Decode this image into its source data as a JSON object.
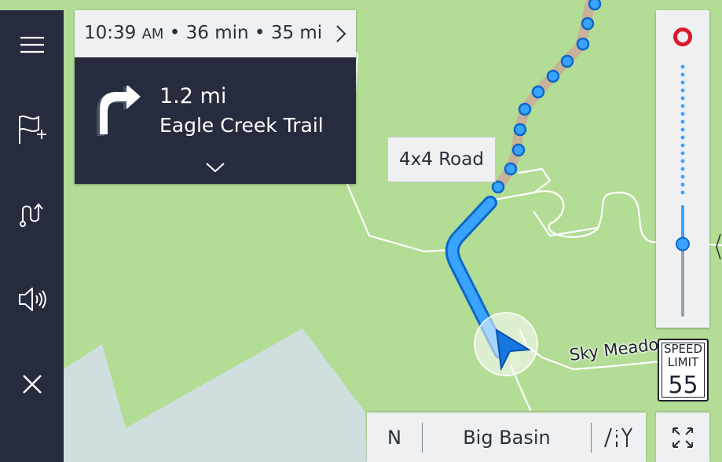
{
  "colors": {
    "map_land": "#b3dc95",
    "map_water": "#cfdfe0",
    "route": "#3aa3ff",
    "route_outline": "#0c68c8",
    "dotted_route": "#c8b298",
    "panel_dark": "#262c3d",
    "panel_light": "#eef0f2",
    "destination_marker": "#d91a2a"
  },
  "sidebar": {
    "items": [
      {
        "icon": "menu-icon"
      },
      {
        "icon": "add-waypoint-flag-icon"
      },
      {
        "icon": "route-options-icon"
      },
      {
        "icon": "volume-icon"
      },
      {
        "icon": "close-icon"
      }
    ]
  },
  "nav_card": {
    "arrival_time": "10:39",
    "arrival_ampm": "AM",
    "separator": "•",
    "duration": "36 min",
    "distance": "35 mi",
    "next_maneuver": {
      "icon": "turn-right-icon",
      "distance": "1.2 mi",
      "street": "Eagle Creek Trail"
    }
  },
  "map": {
    "road_label": "4x4 Road",
    "street_label": "Sky Meado"
  },
  "zoom": {
    "level": 0.28
  },
  "speed_limit": {
    "title_line1": "SPEED",
    "title_line2": "LIMIT",
    "value": "55"
  },
  "bottom_bar": {
    "compass": "N",
    "location": "Big Basin",
    "view_icon": "road-view-icon"
  },
  "fullscreen": {
    "icon": "fullscreen-icon"
  }
}
